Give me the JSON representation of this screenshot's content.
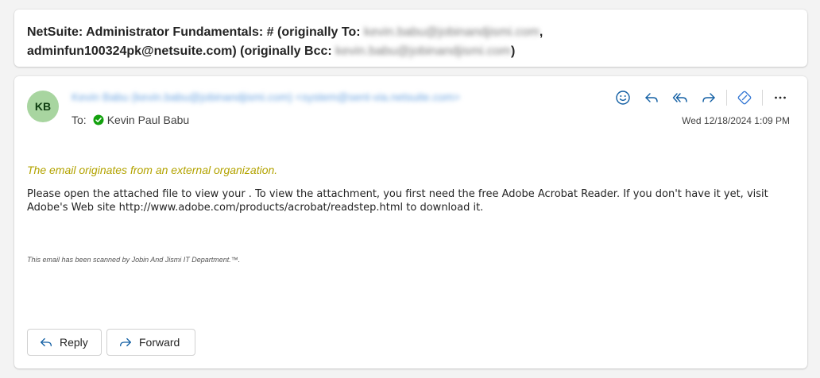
{
  "subject": {
    "prefix": "NetSuite: Administrator Fundamentals:  # (originally To: ",
    "blurred_to": "kevin.babu@jobinandjismi.com",
    "middle": ",",
    "line2": "adminfun100324pk@netsuite.com) (originally Bcc: ",
    "blurred_bcc": "kevin.babu@jobinandjismi.com",
    "suffix": ")"
  },
  "message": {
    "avatar_initials": "KB",
    "sender_blurred": "Kevin Babu (kevin.babu@jobinandjismi.com) <system@sent-via.netsuite.com>",
    "to_label": "To:",
    "to_name": "Kevin Paul Babu",
    "date": "Wed 12/18/2024 1:09 PM",
    "external_warning": "The email originates from an external organization.",
    "body": "Please open the attached file to view your . To view the attachment, you first need the free Adobe Acrobat Reader. If you don't have it yet, visit Adobe's Web site http://www.adobe.com/products/acrobat/readstep.html to download it.",
    "scan_note": "This email has been scanned by Jobin And Jismi IT Department.™.",
    "reply_label": "Reply",
    "forward_label": "Forward"
  },
  "colors": {
    "accent": "#115ea3",
    "avatar_bg": "#a8d5a0",
    "warning_text": "#b3a300",
    "verified_green": "#13a10e"
  },
  "toolbar_icons": [
    "emoji-icon",
    "reply-icon",
    "reply-all-icon",
    "forward-icon",
    "loop-icon",
    "more-icon"
  ]
}
